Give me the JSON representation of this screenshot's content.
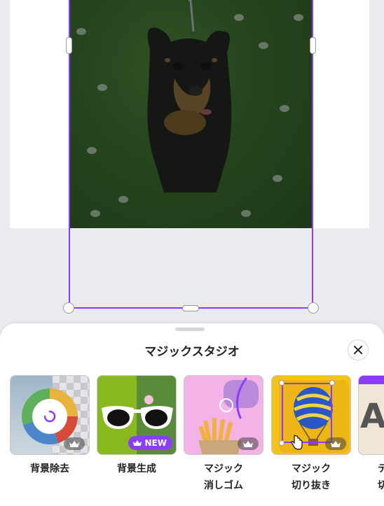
{
  "sheet": {
    "title": "マジックスタジオ",
    "close_icon": "close-icon"
  },
  "tools": [
    {
      "label": "背景除去",
      "badge": "crown"
    },
    {
      "label": "背景生成",
      "badge": "NEW"
    },
    {
      "label": "マジック\n消しゴム",
      "badge": "crown"
    },
    {
      "label": "マジック\n切り抜き",
      "badge": "crown"
    },
    {
      "label": "テ\n切",
      "badge": ""
    }
  ],
  "colors": {
    "accent": "#8b3dff",
    "selection": "#8b3dff"
  }
}
